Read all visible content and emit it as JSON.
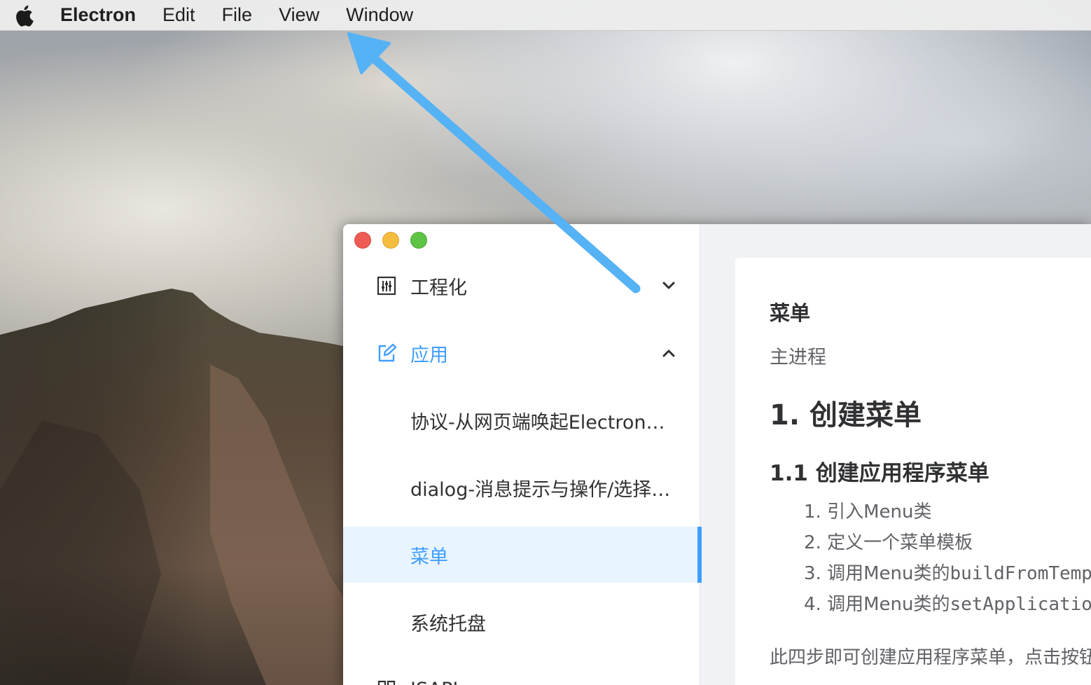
{
  "menubar": {
    "apple_icon": "apple-logo",
    "app_name": "Electron",
    "items": [
      "Edit",
      "File",
      "View",
      "Window"
    ]
  },
  "sidebar": {
    "groups": [
      {
        "label": "工程化",
        "icon": "sliders-icon",
        "expanded": false
      },
      {
        "label": "应用",
        "icon": "edit-icon",
        "expanded": true
      }
    ],
    "sub_items": [
      {
        "label": "协议-从网页端唤起Electron应用",
        "active": false
      },
      {
        "label": "dialog-消息提示与操作/选择文件",
        "active": false
      },
      {
        "label": "菜单",
        "active": true
      },
      {
        "label": "系统托盘",
        "active": false
      }
    ],
    "next_group_partial": "JSAPI"
  },
  "content": {
    "title": "菜单",
    "subtitle": "主进程",
    "h1": "1. 创建菜单",
    "h2": "1.1 创建应用程序菜单",
    "steps": [
      {
        "num": "1.",
        "text": "引入Menu类",
        "code": ""
      },
      {
        "num": "2.",
        "text": "定义一个菜单模板",
        "code": ""
      },
      {
        "num": "3.",
        "text": "调用Menu类的",
        "code": "buildFromTemplate"
      },
      {
        "num": "4.",
        "text": "调用Menu类的",
        "code": "setApplicationMenu"
      }
    ],
    "paragraph": "此四步即可创建应用程序菜单，点击按钮"
  },
  "colors": {
    "accent": "#409eff",
    "active_bg": "#e8f4ff",
    "annotation_arrow": "#55b2f5"
  }
}
